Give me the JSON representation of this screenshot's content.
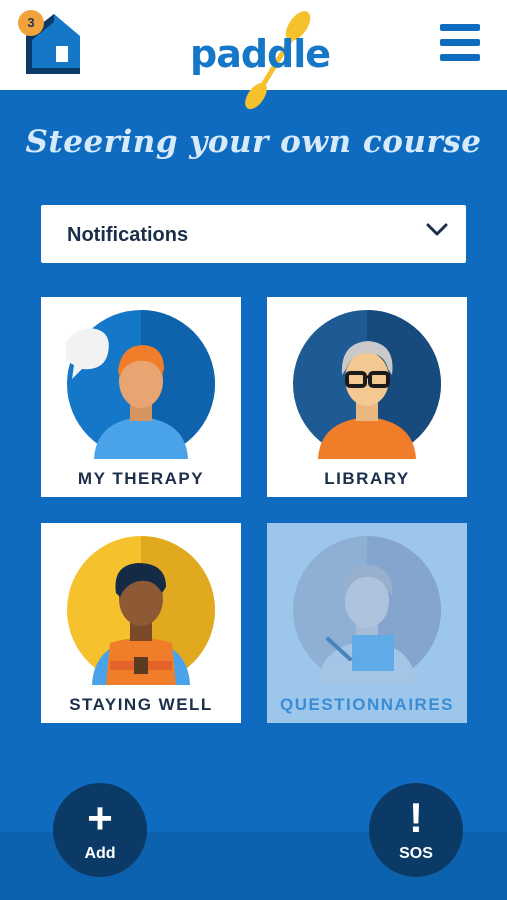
{
  "header": {
    "home_badge_count": "3",
    "logo_text": "paddle",
    "home_icon": "house-icon",
    "menu_icon": "hamburger-menu-icon"
  },
  "tagline": "Steering your own course",
  "notifications": {
    "label": "Notifications",
    "icon": "chevron-down-icon"
  },
  "tiles": [
    {
      "label": "MY THERAPY",
      "icon": "person-speech-bubble-illustration"
    },
    {
      "label": "LIBRARY",
      "icon": "person-glasses-illustration"
    },
    {
      "label": "STAYING WELL",
      "icon": "person-life-jacket-illustration"
    },
    {
      "label": "QUESTIONNAIRES",
      "icon": "person-clipboard-illustration",
      "disabled": true
    }
  ],
  "fab": {
    "add_label": "Add",
    "add_icon": "plus-icon",
    "sos_label": "SOS",
    "sos_icon": "exclamation-icon"
  },
  "colors": {
    "brand_blue": "#0f6bbf",
    "navy": "#0c3a66",
    "badge": "#f2a23a",
    "paddle_yellow": "#f5c22e"
  }
}
